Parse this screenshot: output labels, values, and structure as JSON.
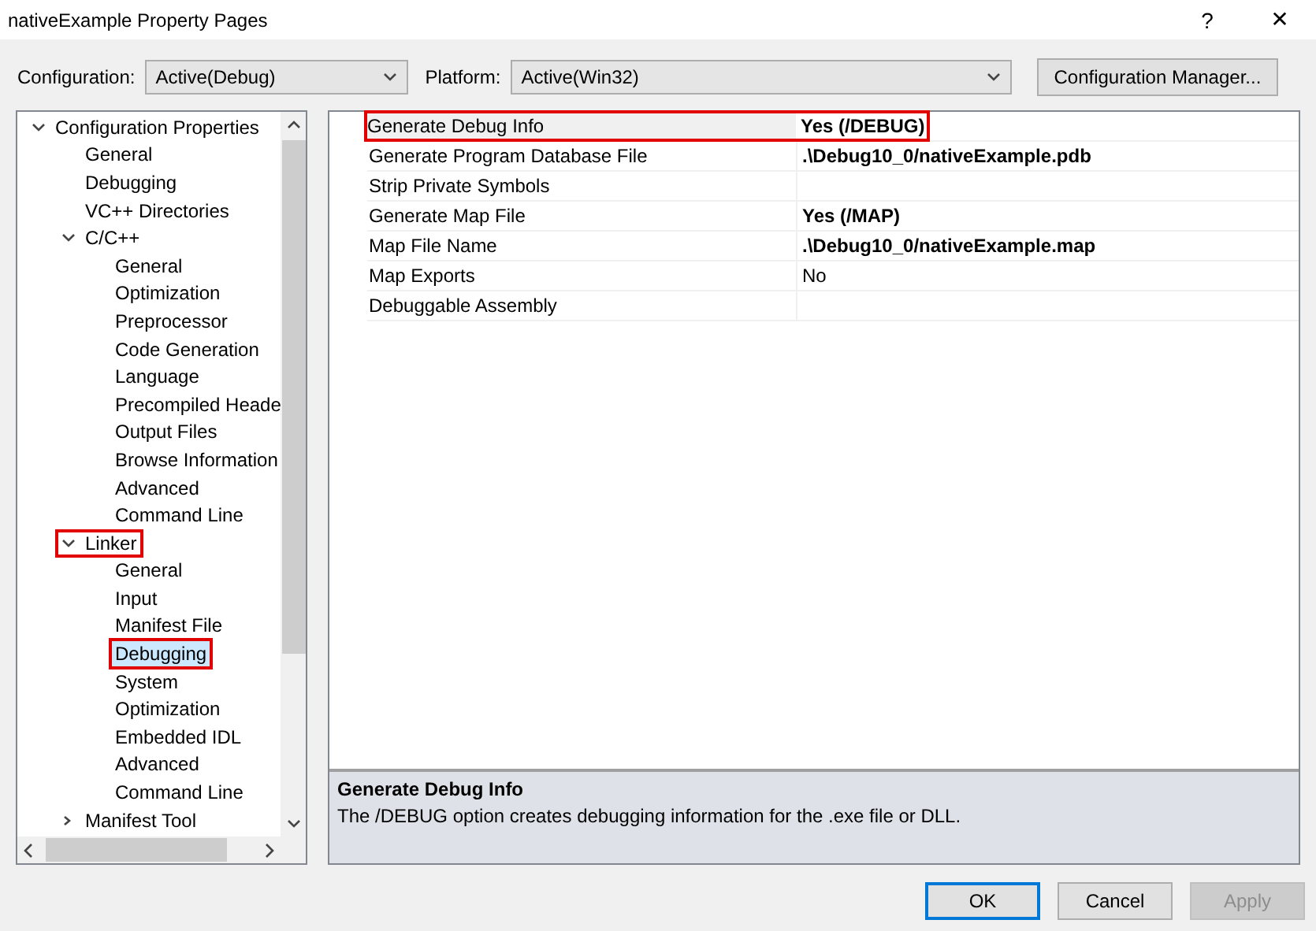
{
  "window": {
    "title": "nativeExample Property Pages",
    "help": "?",
    "close": "✕"
  },
  "config_bar": {
    "configuration_label": "Configuration:",
    "configuration": "Active(Debug)",
    "platform_label": "Platform:",
    "platform": "Active(Win32)",
    "manager_button": "Configuration Manager..."
  },
  "tree": [
    {
      "label": "Configuration Properties",
      "expanded": true,
      "selected": false,
      "highlighted": false,
      "children": [
        {
          "label": "General",
          "selected": false,
          "highlighted": false
        },
        {
          "label": "Debugging",
          "selected": false,
          "highlighted": false
        },
        {
          "label": "VC++ Directories",
          "selected": false,
          "highlighted": false
        },
        {
          "label": "C/C++",
          "expanded": true,
          "selected": false,
          "highlighted": false,
          "children": [
            {
              "label": "General",
              "selected": false,
              "highlighted": false
            },
            {
              "label": "Optimization",
              "selected": false,
              "highlighted": false
            },
            {
              "label": "Preprocessor",
              "selected": false,
              "highlighted": false
            },
            {
              "label": "Code Generation",
              "selected": false,
              "highlighted": false
            },
            {
              "label": "Language",
              "selected": false,
              "highlighted": false
            },
            {
              "label": "Precompiled Heade",
              "selected": false,
              "highlighted": false
            },
            {
              "label": "Output Files",
              "selected": false,
              "highlighted": false
            },
            {
              "label": "Browse Information",
              "selected": false,
              "highlighted": false
            },
            {
              "label": "Advanced",
              "selected": false,
              "highlighted": false
            },
            {
              "label": "Command Line",
              "selected": false,
              "highlighted": false
            }
          ]
        },
        {
          "label": "Linker",
          "expanded": true,
          "selected": false,
          "highlighted": true,
          "children": [
            {
              "label": "General",
              "selected": false,
              "highlighted": false
            },
            {
              "label": "Input",
              "selected": false,
              "highlighted": false
            },
            {
              "label": "Manifest File",
              "selected": false,
              "highlighted": false
            },
            {
              "label": "Debugging",
              "selected": true,
              "highlighted": true
            },
            {
              "label": "System",
              "selected": false,
              "highlighted": false
            },
            {
              "label": "Optimization",
              "selected": false,
              "highlighted": false
            },
            {
              "label": "Embedded IDL",
              "selected": false,
              "highlighted": false
            },
            {
              "label": "Advanced",
              "selected": false,
              "highlighted": false
            },
            {
              "label": "Command Line",
              "selected": false,
              "highlighted": false
            }
          ]
        },
        {
          "label": "Manifest Tool",
          "kind": "group",
          "expanded": false,
          "selected": false,
          "highlighted": false
        }
      ]
    }
  ],
  "properties": [
    {
      "name": "Generate Debug Info",
      "value": "Yes (/DEBUG)",
      "modified": true,
      "selected": true,
      "highlighted": true
    },
    {
      "name": "Generate Program Database File",
      "value": ".\\Debug10_0/nativeExample.pdb",
      "modified": true,
      "selected": false,
      "highlighted": false
    },
    {
      "name": "Strip Private Symbols",
      "selected": false,
      "highlighted": false
    },
    {
      "name": "Generate Map File",
      "value": "Yes (/MAP)",
      "modified": true,
      "selected": false,
      "highlighted": false
    },
    {
      "name": "Map File Name",
      "value": ".\\Debug10_0/nativeExample.map",
      "modified": true,
      "selected": false,
      "highlighted": false
    },
    {
      "name": "Map Exports",
      "value": "No",
      "modified": false,
      "selected": false,
      "highlighted": false
    },
    {
      "name": "Debuggable Assembly",
      "selected": false,
      "highlighted": false
    }
  ],
  "description": {
    "title": "Generate Debug Info",
    "text": "The /DEBUG option creates debugging information for the .exe file or DLL."
  },
  "buttons": [
    {
      "label": "OK",
      "kind": "default",
      "disabled": false
    },
    {
      "label": "Cancel",
      "kind": "normal",
      "disabled": false
    },
    {
      "label": "Apply",
      "kind": "normal",
      "disabled": true
    }
  ]
}
